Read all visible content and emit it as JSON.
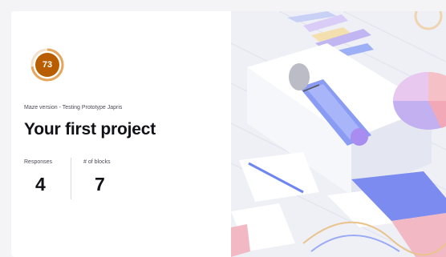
{
  "project": {
    "score": "73",
    "score_fraction": 0.73,
    "subtitle": "Maze version - Testing Prototype Japris",
    "title": "Your first project"
  },
  "stats": [
    {
      "label": "Responses",
      "value": "4"
    },
    {
      "label": "# of blocks",
      "value": "7"
    }
  ],
  "colors": {
    "score_ring": "#e8a55c",
    "score_fill": "#b85e00",
    "illustration_blue": "#7b8bf0",
    "illustration_pink": "#f2b9c4",
    "illustration_purple": "#b8a6f0"
  }
}
